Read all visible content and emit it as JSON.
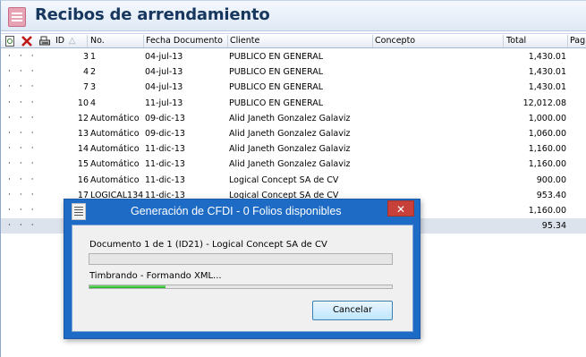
{
  "window": {
    "title": "Recibos de arrendamiento"
  },
  "header": {
    "columns": {
      "id": "ID",
      "no": "No.",
      "fecha": "Fecha Documento",
      "cliente": "Cliente",
      "concepto": "Concepto",
      "total": "Total",
      "pag": "Pag"
    }
  },
  "rows": [
    {
      "id": "3",
      "no": "1",
      "fecha": "04-jul-13",
      "cliente": "PUBLICO EN GENERAL",
      "total": "1,430.01"
    },
    {
      "id": "4",
      "no": "2",
      "fecha": "04-jul-13",
      "cliente": "PUBLICO EN GENERAL",
      "total": "1,430.01"
    },
    {
      "id": "7",
      "no": "3",
      "fecha": "04-jul-13",
      "cliente": "PUBLICO EN GENERAL",
      "total": "1,430.01"
    },
    {
      "id": "10",
      "no": "4",
      "fecha": "11-jul-13",
      "cliente": "PUBLICO EN GENERAL",
      "total": "12,012.08"
    },
    {
      "id": "12",
      "no": "Automático",
      "fecha": "09-dic-13",
      "cliente": "Alid Janeth Gonzalez Galaviz",
      "total": "1,000.00"
    },
    {
      "id": "13",
      "no": "Automático",
      "fecha": "09-dic-13",
      "cliente": "Alid Janeth Gonzalez Galaviz",
      "total": "1,060.00"
    },
    {
      "id": "14",
      "no": "Automático",
      "fecha": "11-dic-13",
      "cliente": "Alid Janeth Gonzalez Galaviz",
      "total": "1,160.00"
    },
    {
      "id": "15",
      "no": "Automático",
      "fecha": "11-dic-13",
      "cliente": "Alid Janeth Gonzalez Galaviz",
      "total": "1,160.00"
    },
    {
      "id": "16",
      "no": "Automático",
      "fecha": "11-dic-13",
      "cliente": "Logical Concept SA de CV",
      "total": "900.00"
    },
    {
      "id": "17",
      "no": "LOGICAL134",
      "fecha": "11-dic-13",
      "cliente": "Logical Concept SA de CV",
      "total": "953.40"
    },
    {
      "id": "",
      "no": "",
      "fecha": "",
      "cliente": "",
      "total": "1,160.00"
    },
    {
      "id": "",
      "no": "",
      "fecha": "",
      "cliente": "",
      "total": "95.34"
    }
  ],
  "dialog": {
    "title": "Generación de CFDI - 0 Folios disponibles",
    "close": "✕",
    "line1": "Documento 1 de 1 (ID21) - Logical Concept SA de CV",
    "progress1": 0.0,
    "line2": "Timbrando - Formando XML...",
    "progress2": 0.25,
    "cancel": "Cancelar"
  },
  "colors": {
    "title": "#17375e",
    "dialog_frame": "#1e6bc6",
    "close": "#c7413a",
    "progress": "#20b020"
  },
  "icons": [
    "document-icon",
    "delete-icon",
    "print-icon",
    "sort-asc-icon",
    "document-icon"
  ]
}
